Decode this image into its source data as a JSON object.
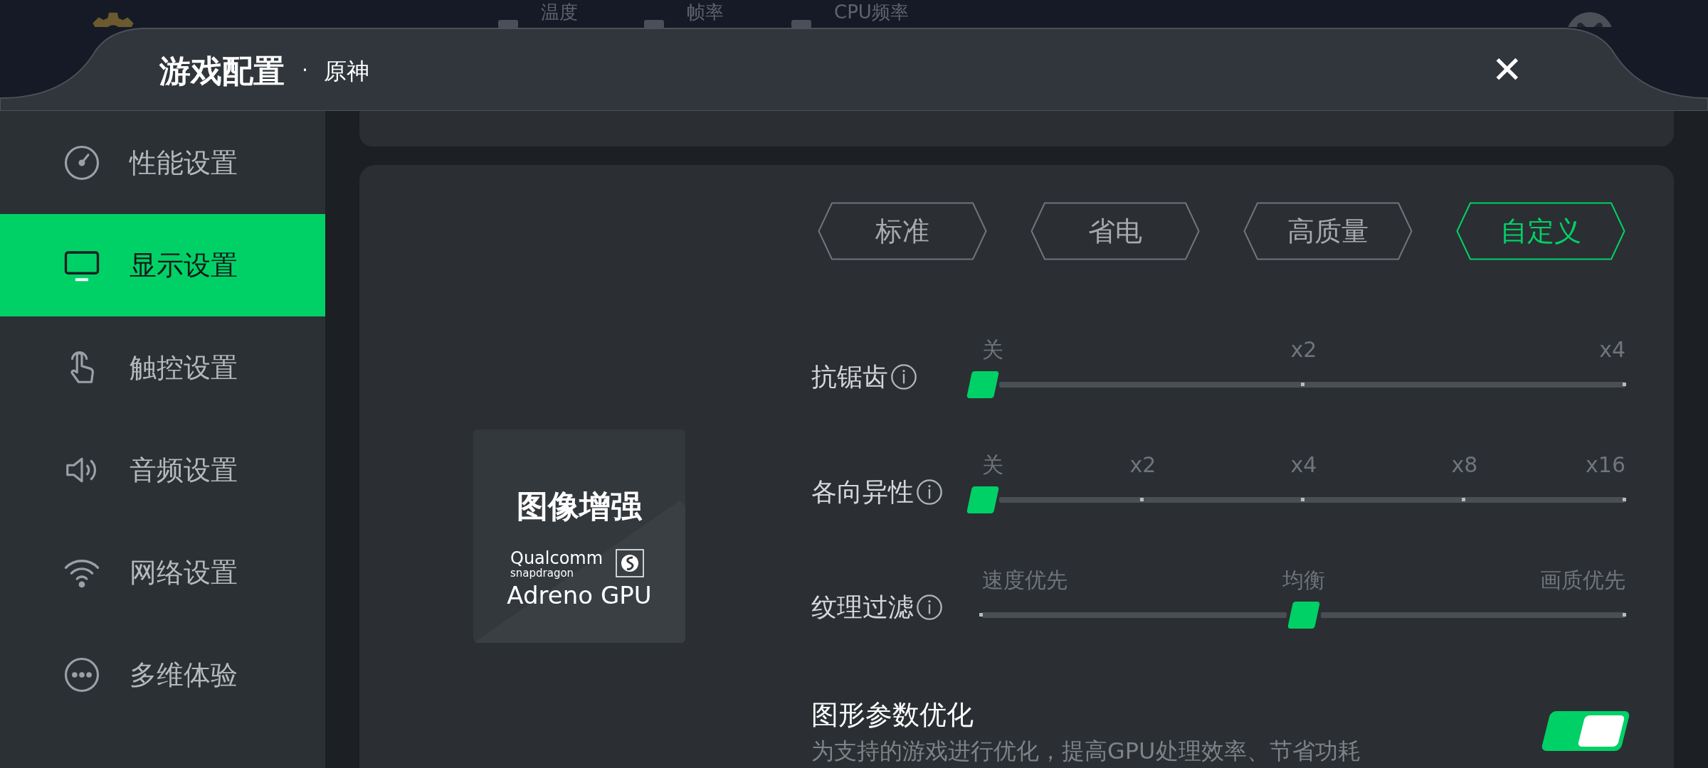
{
  "status_strip": {
    "metrics": [
      "温度",
      "帧率",
      "CPU频率"
    ]
  },
  "header": {
    "title": "游戏配置",
    "separator": "·",
    "game": "原神",
    "close": "✕"
  },
  "sidebar": {
    "items": [
      {
        "label": "性能设置",
        "selected": false
      },
      {
        "label": "显示设置",
        "selected": true
      },
      {
        "label": "触控设置",
        "selected": false
      },
      {
        "label": "音频设置",
        "selected": false
      },
      {
        "label": "网络设置",
        "selected": false
      },
      {
        "label": "多维体验",
        "selected": false
      }
    ]
  },
  "presets": [
    {
      "label": "标准",
      "selected": false
    },
    {
      "label": "省电",
      "selected": false
    },
    {
      "label": "高质量",
      "selected": false
    },
    {
      "label": "自定义",
      "selected": true
    }
  ],
  "feature_card": {
    "title": "图像增强",
    "brand": "Qualcomm",
    "sub_brand": "snapdragon",
    "product": "Adreno GPU"
  },
  "sliders": [
    {
      "label": "抗锯齿",
      "ticks": [
        "关",
        "x2",
        "x4"
      ],
      "level": 0
    },
    {
      "label": "各向异性",
      "ticks": [
        "关",
        "x2",
        "x4",
        "x8",
        "x16"
      ],
      "level": 0
    },
    {
      "label": "纹理过滤",
      "ticks": [
        "速度优先",
        "均衡",
        "画质优先"
      ],
      "level": 0.5
    }
  ],
  "toggle_setting": {
    "title": "图形参数优化",
    "description": "为支持的游戏进行优化，提高GPU处理效率、节省功耗",
    "on": true
  }
}
